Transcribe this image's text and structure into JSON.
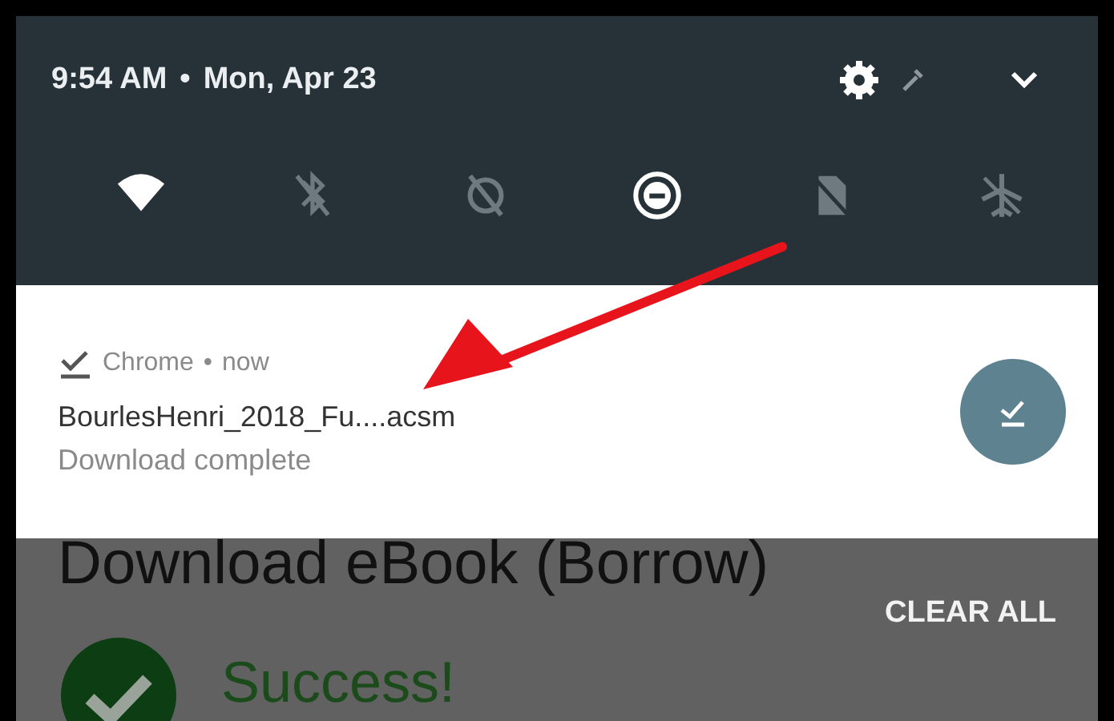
{
  "header": {
    "time": "9:54 AM",
    "separator": "•",
    "date": "Mon, Apr 23"
  },
  "quick_tiles": [
    {
      "kind": "wifi",
      "on": true
    },
    {
      "kind": "bluetooth",
      "on": false
    },
    {
      "kind": "rotate",
      "on": false
    },
    {
      "kind": "dnd",
      "on": true
    },
    {
      "kind": "sim",
      "on": false
    },
    {
      "kind": "airplane",
      "on": false
    }
  ],
  "notification": {
    "app": "Chrome",
    "separator": "•",
    "time": "now",
    "title": "BourlesHenri_2018_Fu....acsm",
    "text": "Download complete"
  },
  "background_page": {
    "heading": "Download eBook (Borrow)",
    "clear_all": "CLEAR ALL",
    "status": "Success!"
  }
}
